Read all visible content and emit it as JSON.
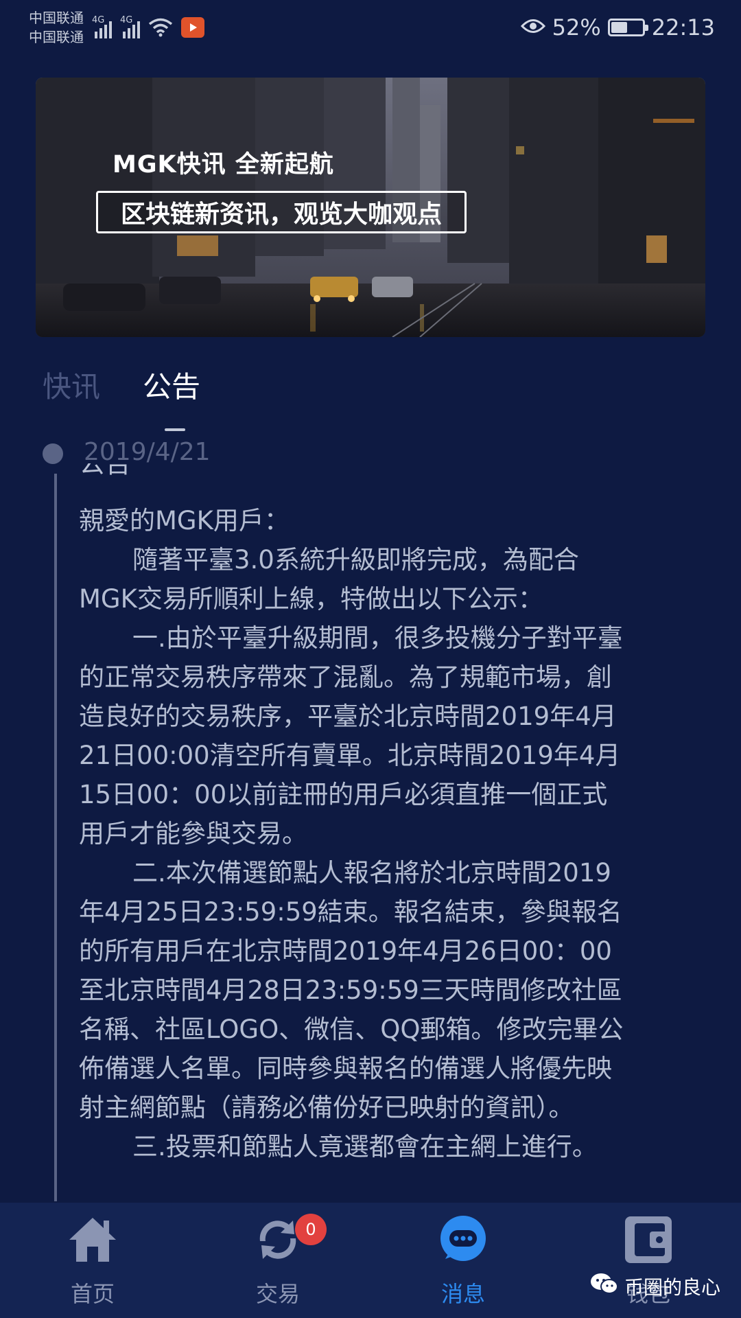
{
  "status_bar": {
    "carrier_1": "中国联通",
    "carrier_2": "中国联通",
    "network_1": "4G",
    "network_2": "4G",
    "battery": "52%",
    "battery_level": 0.52,
    "time": "22:13"
  },
  "banner": {
    "title": "MGK快讯  全新起航",
    "subtitle": "区块链新资讯，观览大咖观点"
  },
  "tabs": [
    {
      "label": "快讯",
      "active": false
    },
    {
      "label": "公告",
      "active": true
    }
  ],
  "announcement": {
    "date": "2019/4/21",
    "title": "公告",
    "paragraphs": [
      "親愛的MGK用戶：",
      "隨著平臺3.0系統升級即將完成，為配合MGK交易所順利上線，特做出以下公示：",
      "一.由於平臺升級期間，很多投機分子對平臺的正常交易秩序帶來了混亂。為了規範市場，創造良好的交易秩序，平臺於北京時間2019年4月21日00:00清空所有賣單。北京時間2019年4月15日00：00以前註冊的用戶必須直推一個正式用戶才能參與交易。",
      "二.本次備選節點人報名將於北京時間2019年4月25日23:59:59結束。報名結束，參與報名的所有用戶在北京時間2019年4月26日00：00至北京時間4月28日23:59:59三天時間修改社區名稱、社區LOGO、微信、QQ郵箱。修改完畢公佈備選人名單。同時參與報名的備選人將優先映射主網節點（請務必備份好已映射的資訊）。",
      "三.投票和節點人竟選都會在主網上進行。"
    ]
  },
  "bottom_nav": [
    {
      "label": "首页",
      "icon": "home-icon",
      "active": false
    },
    {
      "label": "交易",
      "icon": "exchange-icon",
      "active": false,
      "badge": "0"
    },
    {
      "label": "消息",
      "icon": "message-icon",
      "active": true
    },
    {
      "label": "钱包",
      "icon": "wallet-icon",
      "active": false
    }
  ],
  "watermark": "币圈的良心",
  "colors": {
    "background": "#0e1a42",
    "nav_background": "#142453",
    "accent": "#2d8bf0",
    "badge": "#e2413f"
  }
}
